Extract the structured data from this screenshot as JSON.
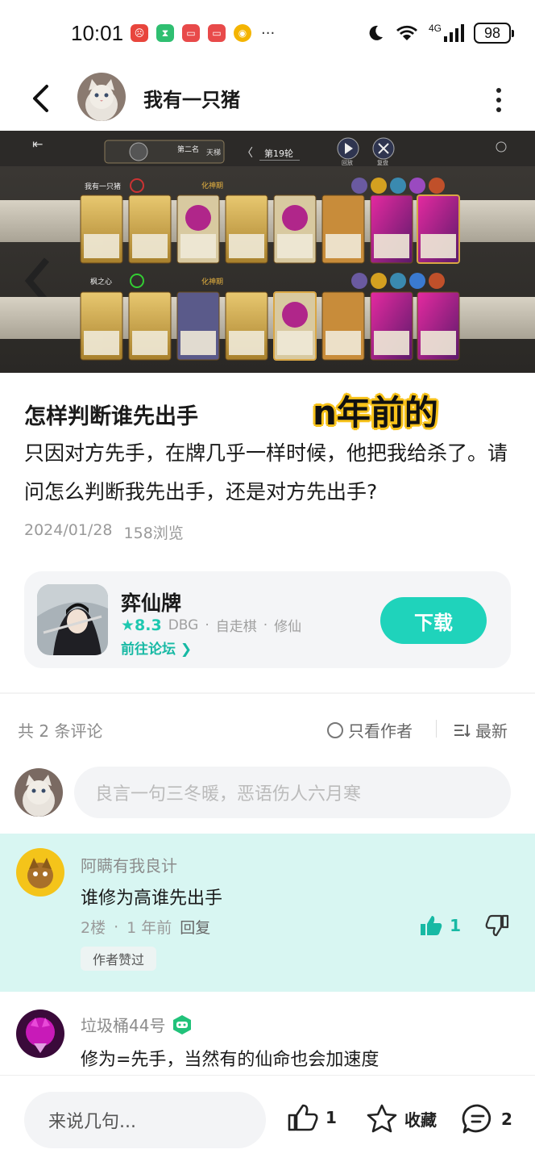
{
  "status_bar": {
    "time": "10:01",
    "more": "···",
    "network": "4G",
    "battery": "98"
  },
  "header": {
    "username": "我有一只猪"
  },
  "game_screen": {
    "rank_label": "第二名",
    "rank_badge": "天梯",
    "round": "第19轮",
    "review_label": "回放",
    "exit_label": "复盘",
    "player1": "我有一只猪",
    "player1_stage": "化神期",
    "player2": "枫之心",
    "player2_stage": "化神期"
  },
  "post": {
    "title": "怎样判断谁先出手",
    "sticker": "n年前的",
    "body": "只因对方先手，在牌几乎一样时候，他把我给杀了。请问怎么判断我先出手，还是对方先出手?",
    "date": "2024/01/28",
    "views": "158浏览"
  },
  "game_card": {
    "name": "弈仙牌",
    "score": "★8.3",
    "tags": [
      "DBG",
      "自走棋",
      "修仙"
    ],
    "forum_link": "前往论坛 ❯",
    "download_label": "下载"
  },
  "comments_header": {
    "count": "共 2 条评论",
    "only_author": "只看作者",
    "sort": "最新"
  },
  "comment_input": {
    "placeholder": "良言一句三冬暖，恶语伤人六月寒"
  },
  "comments": [
    {
      "name": "阿瞒有我良计",
      "text": "谁修为高谁先出手",
      "floor": "2楼",
      "time": "1 年前",
      "reply": "回复",
      "likes": "1",
      "badge": "作者赞过"
    },
    {
      "name": "垃圾桶44号",
      "text": "修为=先手，当然有的仙命也会加速度"
    }
  ],
  "bottom_bar": {
    "placeholder": "来说几句...",
    "likes": "1",
    "favorite": "收藏",
    "comments": "2"
  },
  "colors": {
    "accent": "#1fd3bb",
    "highlight_bg": "#d8f6f2",
    "sticker": "#f7c21a"
  }
}
